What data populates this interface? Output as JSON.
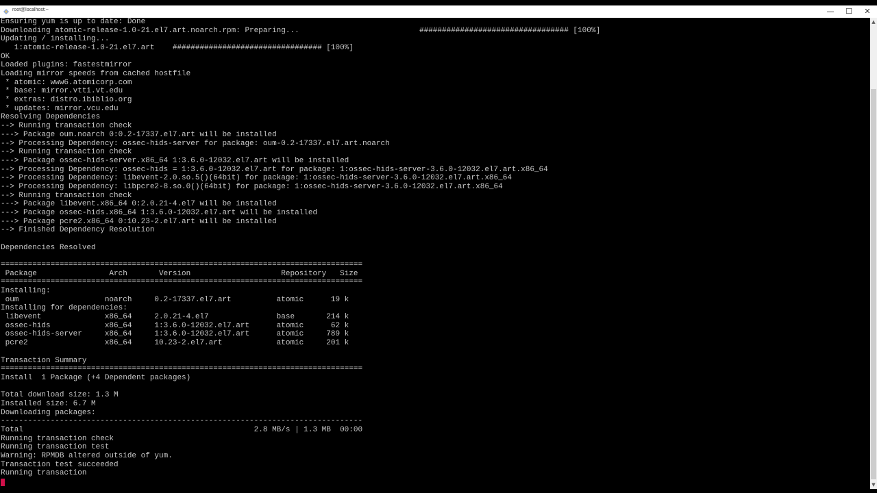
{
  "window": {
    "title": "root@localhost:~",
    "minimize": "—",
    "maximize": "☐",
    "close": "✕"
  },
  "terminal": {
    "progress_right": "################################# [100%]",
    "lines": [
      "Ensuring yum is up to date: Done",
      "Downloading atomic-release-1.0-21.el7.art.noarch.rpm: Preparing...",
      "Updating / installing...",
      "   1:atomic-release-1.0-21.el7.art    ################################# [100%]",
      "OK",
      "Loaded plugins: fastestmirror",
      "Loading mirror speeds from cached hostfile",
      " * atomic: www6.atomicorp.com",
      " * base: mirror.vtti.vt.edu",
      " * extras: distro.ibiblio.org",
      " * updates: mirror.vcu.edu",
      "Resolving Dependencies",
      "--> Running transaction check",
      "---> Package oum.noarch 0:0.2-17337.el7.art will be installed",
      "--> Processing Dependency: ossec-hids-server for package: oum-0.2-17337.el7.art.noarch",
      "--> Running transaction check",
      "---> Package ossec-hids-server.x86_64 1:3.6.0-12032.el7.art will be installed",
      "--> Processing Dependency: ossec-hids = 1:3.6.0-12032.el7.art for package: 1:ossec-hids-server-3.6.0-12032.el7.art.x86_64",
      "--> Processing Dependency: libevent-2.0.so.5()(64bit) for package: 1:ossec-hids-server-3.6.0-12032.el7.art.x86_64",
      "--> Processing Dependency: libpcre2-8.so.0()(64bit) for package: 1:ossec-hids-server-3.6.0-12032.el7.art.x86_64",
      "--> Running transaction check",
      "---> Package libevent.x86_64 0:2.0.21-4.el7 will be installed",
      "---> Package ossec-hids.x86_64 1:3.6.0-12032.el7.art will be installed",
      "---> Package pcre2.x86_64 0:10.23-2.el7.art will be installed",
      "--> Finished Dependency Resolution",
      "",
      "Dependencies Resolved",
      "",
      "================================================================================",
      " Package                Arch       Version                    Repository   Size",
      "================================================================================",
      "Installing:",
      " oum                   noarch     0.2-17337.el7.art          atomic      19 k",
      "Installing for dependencies:",
      " libevent              x86_64     2.0.21-4.el7               base       214 k",
      " ossec-hids            x86_64     1:3.6.0-12032.el7.art      atomic      62 k",
      " ossec-hids-server     x86_64     1:3.6.0-12032.el7.art      atomic     789 k",
      " pcre2                 x86_64     10.23-2.el7.art            atomic     201 k",
      "",
      "Transaction Summary",
      "================================================================================",
      "Install  1 Package (+4 Dependent packages)",
      "",
      "Total download size: 1.3 M",
      "Installed size: 6.7 M",
      "Downloading packages:",
      "--------------------------------------------------------------------------------",
      "Total                                                   2.8 MB/s | 1.3 MB  00:00",
      "Running transaction check",
      "Running transaction test",
      "Warning: RPMDB altered outside of yum.",
      "Transaction test succeeded",
      "Running transaction"
    ]
  },
  "colors": {
    "cursor": "#d0104a",
    "text": "#c8c8c8",
    "background": "#000000"
  }
}
